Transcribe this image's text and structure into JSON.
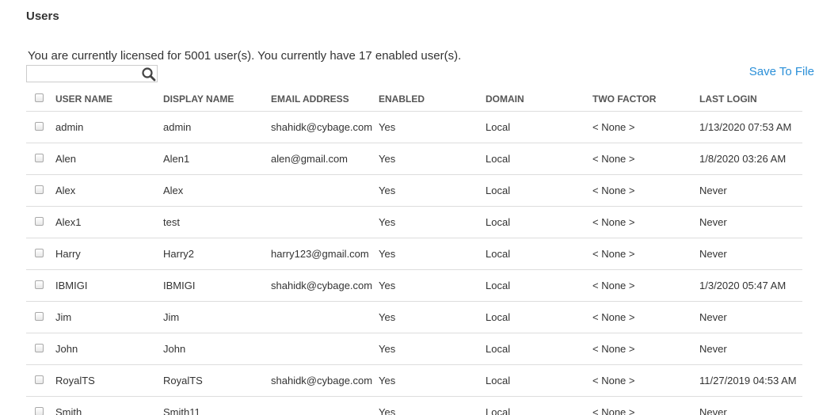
{
  "page": {
    "title": "Users",
    "license_text": "You are currently licensed for 5001 user(s). You currently have 17 enabled user(s).",
    "save_link": "Save To File"
  },
  "search": {
    "placeholder": "",
    "value": "",
    "icon": "search-icon"
  },
  "table": {
    "columns": [
      "USER NAME",
      "DISPLAY NAME",
      "EMAIL ADDRESS",
      "ENABLED",
      "DOMAIN",
      "TWO FACTOR",
      "LAST LOGIN"
    ],
    "rows": [
      {
        "user": "admin",
        "display": "admin",
        "email": "shahidk@cybage.com",
        "enabled": "Yes",
        "domain": "Local",
        "two_factor": "< None >",
        "last_login": "1/13/2020 07:53 AM"
      },
      {
        "user": "Alen",
        "display": "Alen1",
        "email": "alen@gmail.com",
        "enabled": "Yes",
        "domain": "Local",
        "two_factor": "< None >",
        "last_login": "1/8/2020 03:26 AM"
      },
      {
        "user": "Alex",
        "display": "Alex",
        "email": "",
        "enabled": "Yes",
        "domain": "Local",
        "two_factor": "< None >",
        "last_login": "Never"
      },
      {
        "user": "Alex1",
        "display": "test",
        "email": "",
        "enabled": "Yes",
        "domain": "Local",
        "two_factor": "< None >",
        "last_login": "Never"
      },
      {
        "user": "Harry",
        "display": "Harry2",
        "email": "harry123@gmail.com",
        "enabled": "Yes",
        "domain": "Local",
        "two_factor": "< None >",
        "last_login": "Never"
      },
      {
        "user": "IBMIGI",
        "display": "IBMIGI",
        "email": "shahidk@cybage.com",
        "enabled": "Yes",
        "domain": "Local",
        "two_factor": "< None >",
        "last_login": "1/3/2020 05:47 AM"
      },
      {
        "user": "Jim",
        "display": "Jim",
        "email": "",
        "enabled": "Yes",
        "domain": "Local",
        "two_factor": "< None >",
        "last_login": "Never"
      },
      {
        "user": "John",
        "display": "John",
        "email": "",
        "enabled": "Yes",
        "domain": "Local",
        "two_factor": "< None >",
        "last_login": "Never"
      },
      {
        "user": "RoyalTS",
        "display": "RoyalTS",
        "email": "shahidk@cybage.com",
        "enabled": "Yes",
        "domain": "Local",
        "two_factor": "< None >",
        "last_login": "11/27/2019 04:53 AM"
      },
      {
        "user": "Smith",
        "display": "Smith11",
        "email": "",
        "enabled": "Yes",
        "domain": "Local",
        "two_factor": "< None >",
        "last_login": "Never"
      }
    ]
  },
  "colors": {
    "link": "#2a8fd8",
    "text": "#333333",
    "border": "#dddddd"
  }
}
